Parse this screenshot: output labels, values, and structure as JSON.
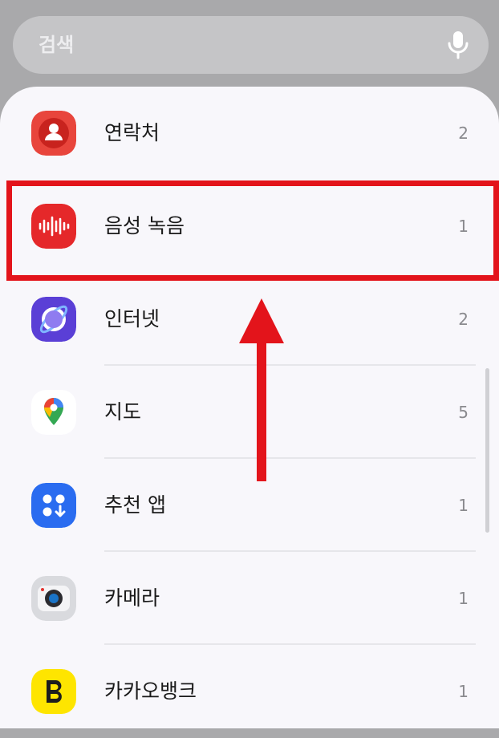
{
  "search": {
    "placeholder": "검색",
    "mic_icon": "mic-icon"
  },
  "apps": [
    {
      "label": "연락처",
      "count": "2",
      "icon": "contacts-icon",
      "color": "#e8453c"
    },
    {
      "label": "음성 녹음",
      "count": "1",
      "icon": "voice-recorder-icon",
      "color": "#e5282a"
    },
    {
      "label": "인터넷",
      "count": "2",
      "icon": "internet-icon",
      "color": "#5a3fd6"
    },
    {
      "label": "지도",
      "count": "5",
      "icon": "maps-icon",
      "color": "#ffffff"
    },
    {
      "label": "추천 앱",
      "count": "1",
      "icon": "recommended-apps-icon",
      "color": "#2a6cf0"
    },
    {
      "label": "카메라",
      "count": "1",
      "icon": "camera-icon",
      "color": "#d9dade"
    },
    {
      "label": "카카오뱅크",
      "count": "1",
      "icon": "kakaobank-icon",
      "color": "#fee500"
    }
  ],
  "annotation": {
    "highlight_color": "#e3141b"
  }
}
